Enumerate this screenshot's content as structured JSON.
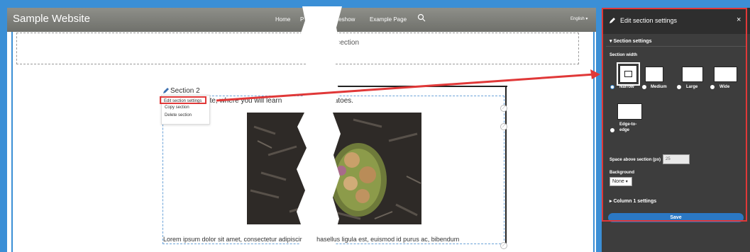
{
  "site": {
    "logo": "Sample Website",
    "nav": [
      "Home",
      "P",
      "ideshow",
      "Example Page"
    ],
    "language": "English"
  },
  "editor": {
    "add_section_text": "d section",
    "section_label": "Section 2",
    "context_menu": [
      "Edit section settings",
      "Copy section",
      "Delete section"
    ],
    "intro_text": "website, where you will learn",
    "intro_text_end": "tatoes.",
    "lorem_text": "Lorem ipsum dolor sit amet, consectetur adipiscir",
    "lorem_text_end": "hasellus ligula est, euismod id purus ac, bibendum"
  },
  "panel": {
    "title": "Edit section settings",
    "close": "×",
    "section_settings": "▾ Section settings",
    "section_width_label": "Section width",
    "width_options": [
      "Narrow",
      "Medium",
      "Large",
      "Wide",
      "Edge-to-edge"
    ],
    "selected_width": "Narrow",
    "space_above_label": "Space above section (px)",
    "space_above_value": "25",
    "background_label": "Background",
    "background_value": "None",
    "column_settings": "▸ Column 1 settings",
    "save": "Save"
  },
  "colors": {
    "accent": "#3b8fd6",
    "highlight": "#e03838",
    "save": "#2b78c4",
    "panel_bg": "#3d3d3d"
  },
  "icons": [
    "pencil-icon",
    "search-icon",
    "close-icon",
    "chevron-down-icon"
  ]
}
